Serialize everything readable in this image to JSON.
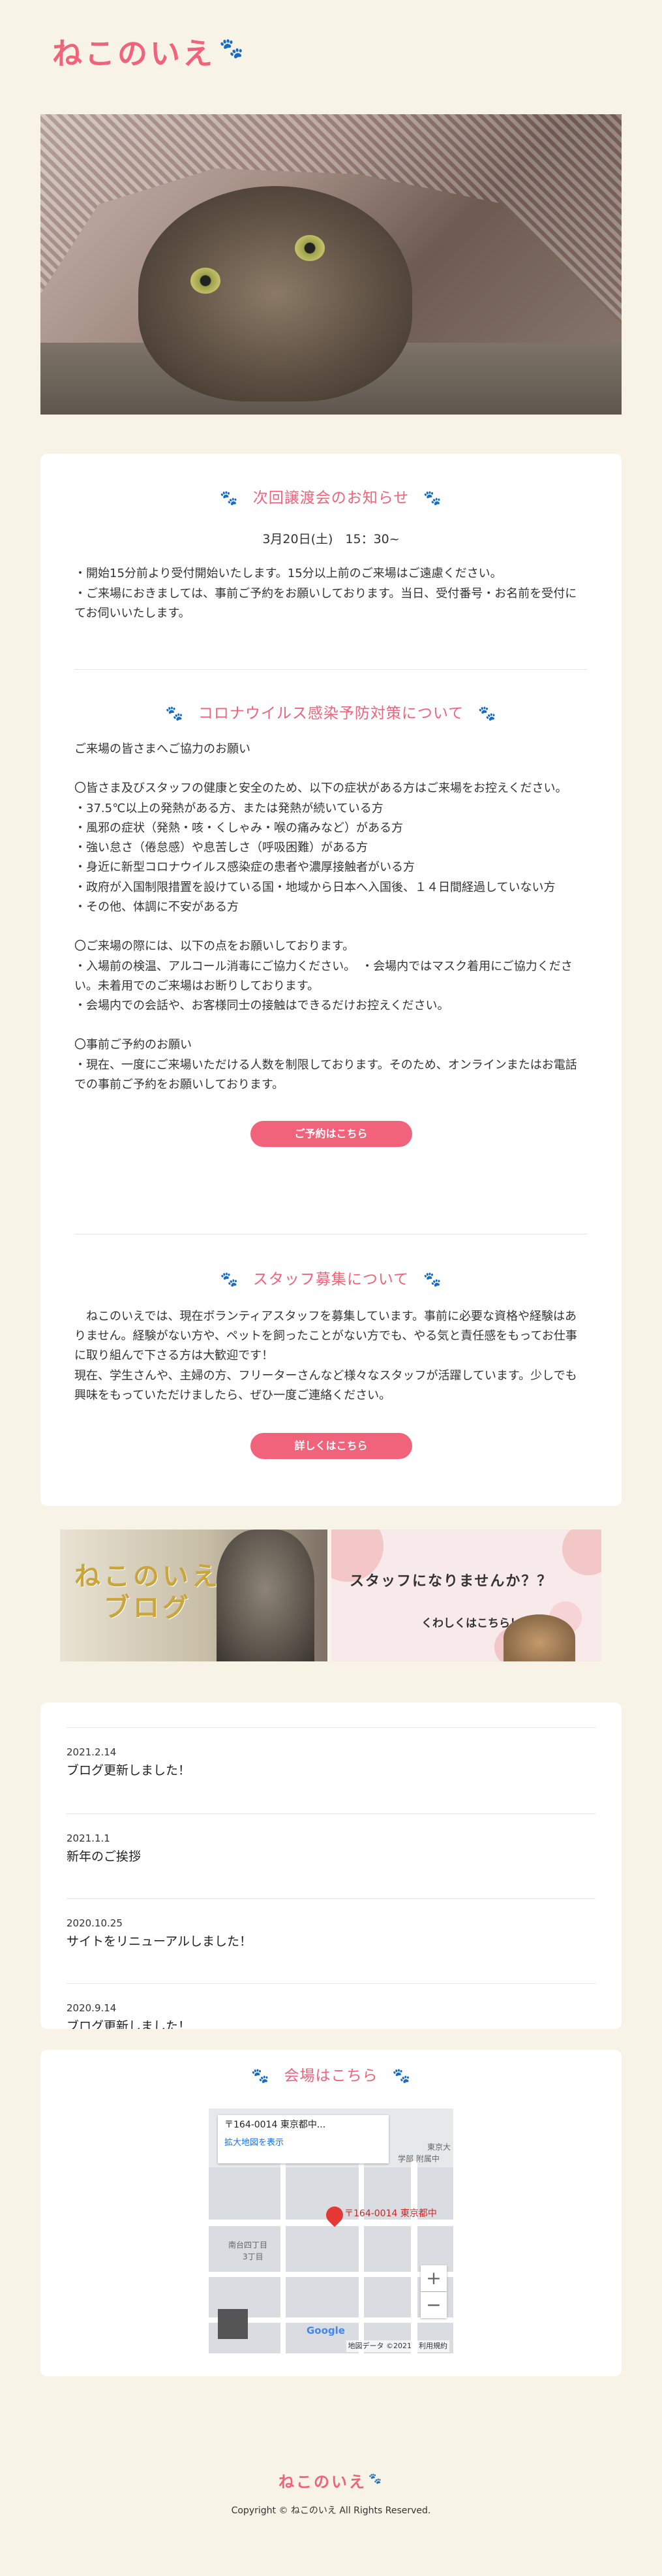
{
  "header": {
    "logo_text": "ねこのいえ",
    "logo_icon": "paw-icon"
  },
  "hero": {
    "alt": "cat under blanket photo"
  },
  "next_event": {
    "title": "次回譲渡会のお知らせ",
    "date": "3月20日(土)　15：30~",
    "body": "・開始15分前より受付開始いたします。15分以上前のご来場はご遠慮ください。\n・ご来場におきましては、事前ご予約をお願いしております。当日、受付番号・お名前を受付にてお伺いいたします。"
  },
  "corona": {
    "title": "コロナウイルス感染予防対策について",
    "body": "ご来場の皆さまへご協力のお願い\n\n〇皆さま及びスタッフの健康と安全のため、以下の症状がある方はご来場をお控えください。\n・37.5℃以上の発熱がある方、または発熱が続いている方\n・風邪の症状（発熱・咳・くしゃみ・喉の痛みなど）がある方\n・強い怠さ（倦怠感）や息苦しさ（呼吸困難）がある方\n・身近に新型コロナウイルス感染症の患者や濃厚接触者がいる方\n・政府が入国制限措置を設けている国・地域から日本へ入国後、１４日間経過していない方\n・その他、体調に不安がある方\n\n〇ご来場の際には、以下の点をお願いしております。\n・入場前の検温、アルコール消毒にご協力ください。　・会場内ではマスク着用にご協力ください。未着用でのご来場はお断りしております。\n・会場内での会話や、お客様同士の接触はできるだけお控えください。\n\n〇事前ご予約のお願い\n・現在、一度にご来場いただける人数を制限しております。そのため、オンラインまたはお電話での事前ご予約をお願いしております。",
    "button": "ご予約はこちら"
  },
  "staff": {
    "title": "スタッフ募集について",
    "body": "　ねこのいえでは、現在ボランティアスタッフを募集しています。事前に必要な資格や経験はありません。経験がない方や、ペットを飼ったことがない方でも、やる気と責任感をもってお仕事に取り組んで下さる方は大歓迎です！\n現在、学生さんや、主婦の方、フリーターさんなど様々なスタッフが活躍しています。少しでも興味をもっていただけましたら、ぜひ一度ご連絡ください。",
    "button": "詳しくはこちら"
  },
  "banners": {
    "blog_line1": "ねこのいえ",
    "blog_line2": "ブログ",
    "staff_line1": "スタッフになりませんか？？",
    "staff_line2": "くわしくはこちら！"
  },
  "news": [
    {
      "date": "2021.2.14",
      "title": "ブログ更新しました！"
    },
    {
      "date": "2021.1.1",
      "title": "新年のご挨拶"
    },
    {
      "date": "2020.10.25",
      "title": "サイトをリニューアルしました！"
    },
    {
      "date": "2020.9.14",
      "title": "ブログ更新しました！"
    }
  ],
  "venue": {
    "title": "会場はこちら",
    "map": {
      "address": "〒164-0014 東京都中...",
      "link": "拡大地図を表示",
      "pin_label": "〒164-0014 東京都中",
      "zoom_in": "+",
      "zoom_out": "−",
      "brand": "Google",
      "attribution": "地図データ ©2021　利用規約",
      "label_school": "学部 附属中",
      "label_tokyo": "東京大",
      "label_park": "南台四丁目",
      "label_chome": "3丁目"
    }
  },
  "footer": {
    "logo_text": "ねこのいえ",
    "copyright": "Copyright © ねこのいえ All Rights Reserved."
  },
  "colors": {
    "accent": "#f0637a",
    "background": "#f8f3e7",
    "card": "#ffffff"
  }
}
